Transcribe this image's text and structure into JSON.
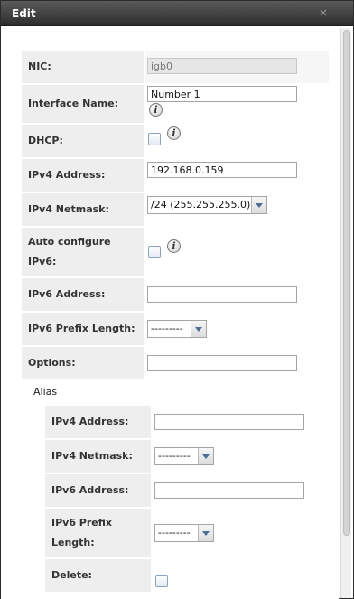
{
  "dialog": {
    "title": "Edit",
    "close_glyph": "×"
  },
  "form": {
    "nic": {
      "label": "NIC:",
      "value": "igb0"
    },
    "interface_name": {
      "label": "Interface Name:",
      "value": "Number 1"
    },
    "dhcp": {
      "label": "DHCP:",
      "checked": false
    },
    "ipv4_address": {
      "label": "IPv4 Address:",
      "value": "192.168.0.159"
    },
    "ipv4_netmask": {
      "label": "IPv4 Netmask:",
      "value": "/24 (255.255.255.0)"
    },
    "auto_ipv6": {
      "label_line1": "Auto configure",
      "label_line2": "IPv6:",
      "checked": false
    },
    "ipv6_address": {
      "label": "IPv6 Address:",
      "value": ""
    },
    "ipv6_prefix": {
      "label": "IPv6 Prefix Length:",
      "value": "---------"
    },
    "options": {
      "label": "Options:",
      "value": ""
    }
  },
  "alias": {
    "title": "Alias",
    "ipv4_address": {
      "label": "IPv4 Address:",
      "value": ""
    },
    "ipv4_netmask": {
      "label": "IPv4 Netmask:",
      "value": "---------"
    },
    "ipv6_address": {
      "label": "IPv6 Address:",
      "value": ""
    },
    "ipv6_prefix": {
      "label_line1": "IPv6 Prefix",
      "label_line2": "Length:",
      "value": "---------"
    },
    "delete": {
      "label": "Delete:",
      "checked": false
    }
  },
  "icons": {
    "info": "info-icon",
    "close": "close-icon",
    "dropdown": "chevron-down-icon"
  },
  "colors": {
    "titlebar": "#3a3a3a",
    "label_bg": "#eeeeee",
    "dropdown_arrow": "#4a6e96"
  }
}
